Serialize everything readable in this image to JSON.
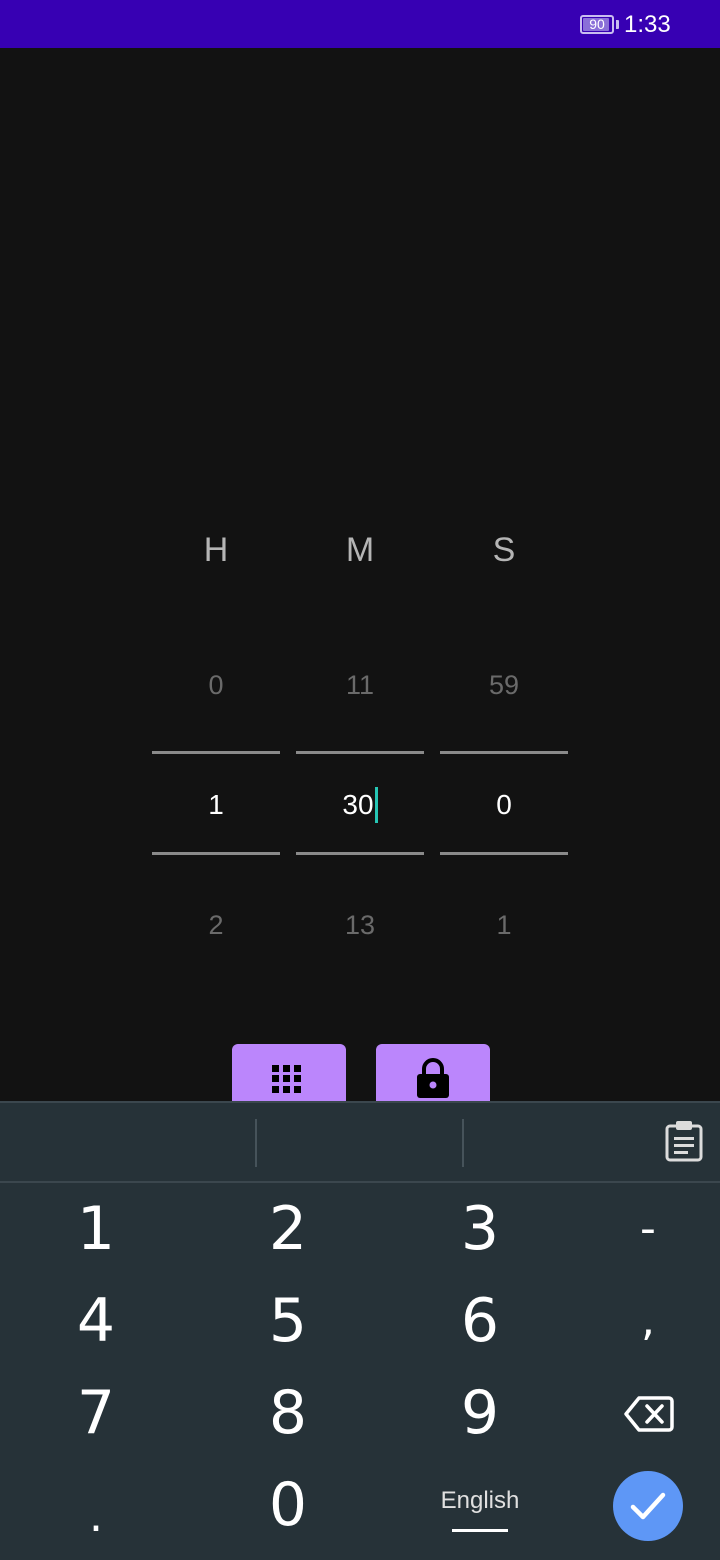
{
  "status_bar": {
    "battery": "90",
    "time": "1:33",
    "color": "#3700b3"
  },
  "picker": {
    "headers": {
      "hours": "H",
      "minutes": "M",
      "seconds": "S"
    },
    "hours": {
      "prev": "0",
      "current": "1",
      "next": "2"
    },
    "minutes": {
      "prev": "11",
      "current": "30",
      "next": "13"
    },
    "seconds": {
      "prev": "59",
      "current": "0",
      "next": "1"
    }
  },
  "actions": {
    "color": "#bb86fc",
    "buttons": [
      "keypad-icon",
      "lock-icon"
    ]
  },
  "keyboard": {
    "keys": {
      "k1": "1",
      "k2": "2",
      "k3": "3",
      "minus": "-",
      "k4": "4",
      "k5": "5",
      "k6": "6",
      "comma": ",",
      "k7": "7",
      "k8": "8",
      "k9": "9",
      "dot": ".",
      "k0": "0"
    },
    "language": "English",
    "enter_color": "#5e97f6"
  }
}
